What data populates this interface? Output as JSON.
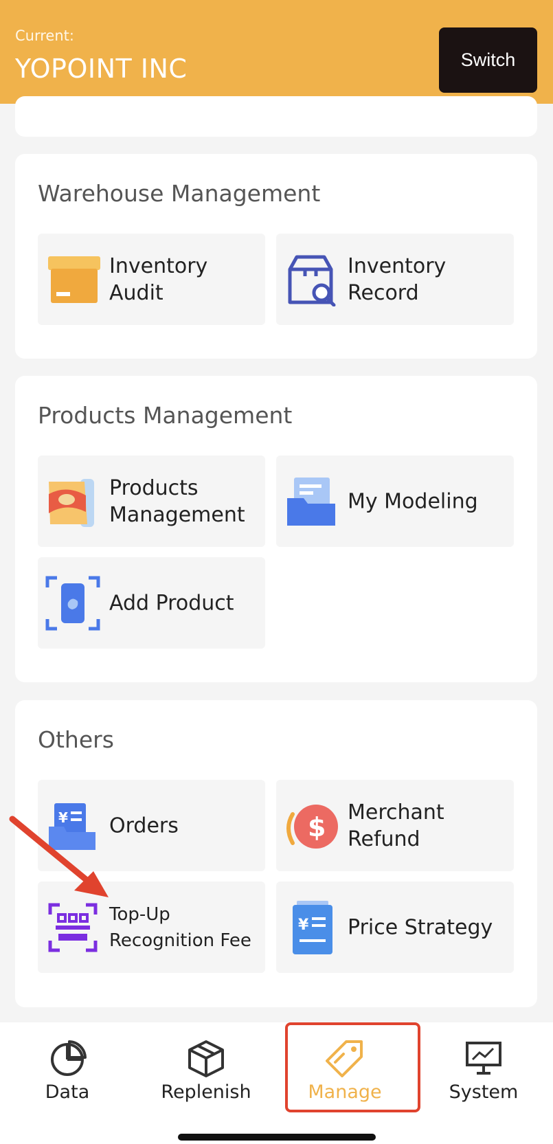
{
  "header": {
    "current_label": "Current:",
    "current_value": "YOPOINT INC",
    "switch_label": "Switch",
    "color": "#f0b24b"
  },
  "warehouse": {
    "title": "Warehouse Management",
    "items": [
      {
        "label": "Inventory\nAudit",
        "icon": "box-icon"
      },
      {
        "label": "Inventory\nRecord",
        "icon": "box-search-icon"
      }
    ]
  },
  "products": {
    "title": "Products Management",
    "items": [
      {
        "label": "Products\nManagement",
        "icon": "snacks-icon"
      },
      {
        "label": "My Modeling",
        "icon": "folder-icon"
      },
      {
        "label": "Add Product",
        "icon": "scan-can-icon"
      }
    ]
  },
  "others": {
    "title": "Others",
    "items": [
      {
        "label": "Orders",
        "icon": "orders-icon"
      },
      {
        "label": "Merchant\nRefund",
        "icon": "refund-dollar-icon"
      },
      {
        "label": "Top-Up\nRecognition Fee",
        "icon": "scan-code-icon"
      },
      {
        "label": "Price Strategy",
        "icon": "price-list-icon"
      }
    ]
  },
  "tabbar": {
    "tabs": [
      {
        "label": "Data",
        "icon": "pie-chart-icon"
      },
      {
        "label": "Replenish",
        "icon": "package-icon"
      },
      {
        "label": "Manage",
        "icon": "tag-icon",
        "active": true
      },
      {
        "label": "System",
        "icon": "presentation-icon"
      }
    ],
    "active_color": "#f0b24b",
    "highlight_color": "#e0432e"
  }
}
